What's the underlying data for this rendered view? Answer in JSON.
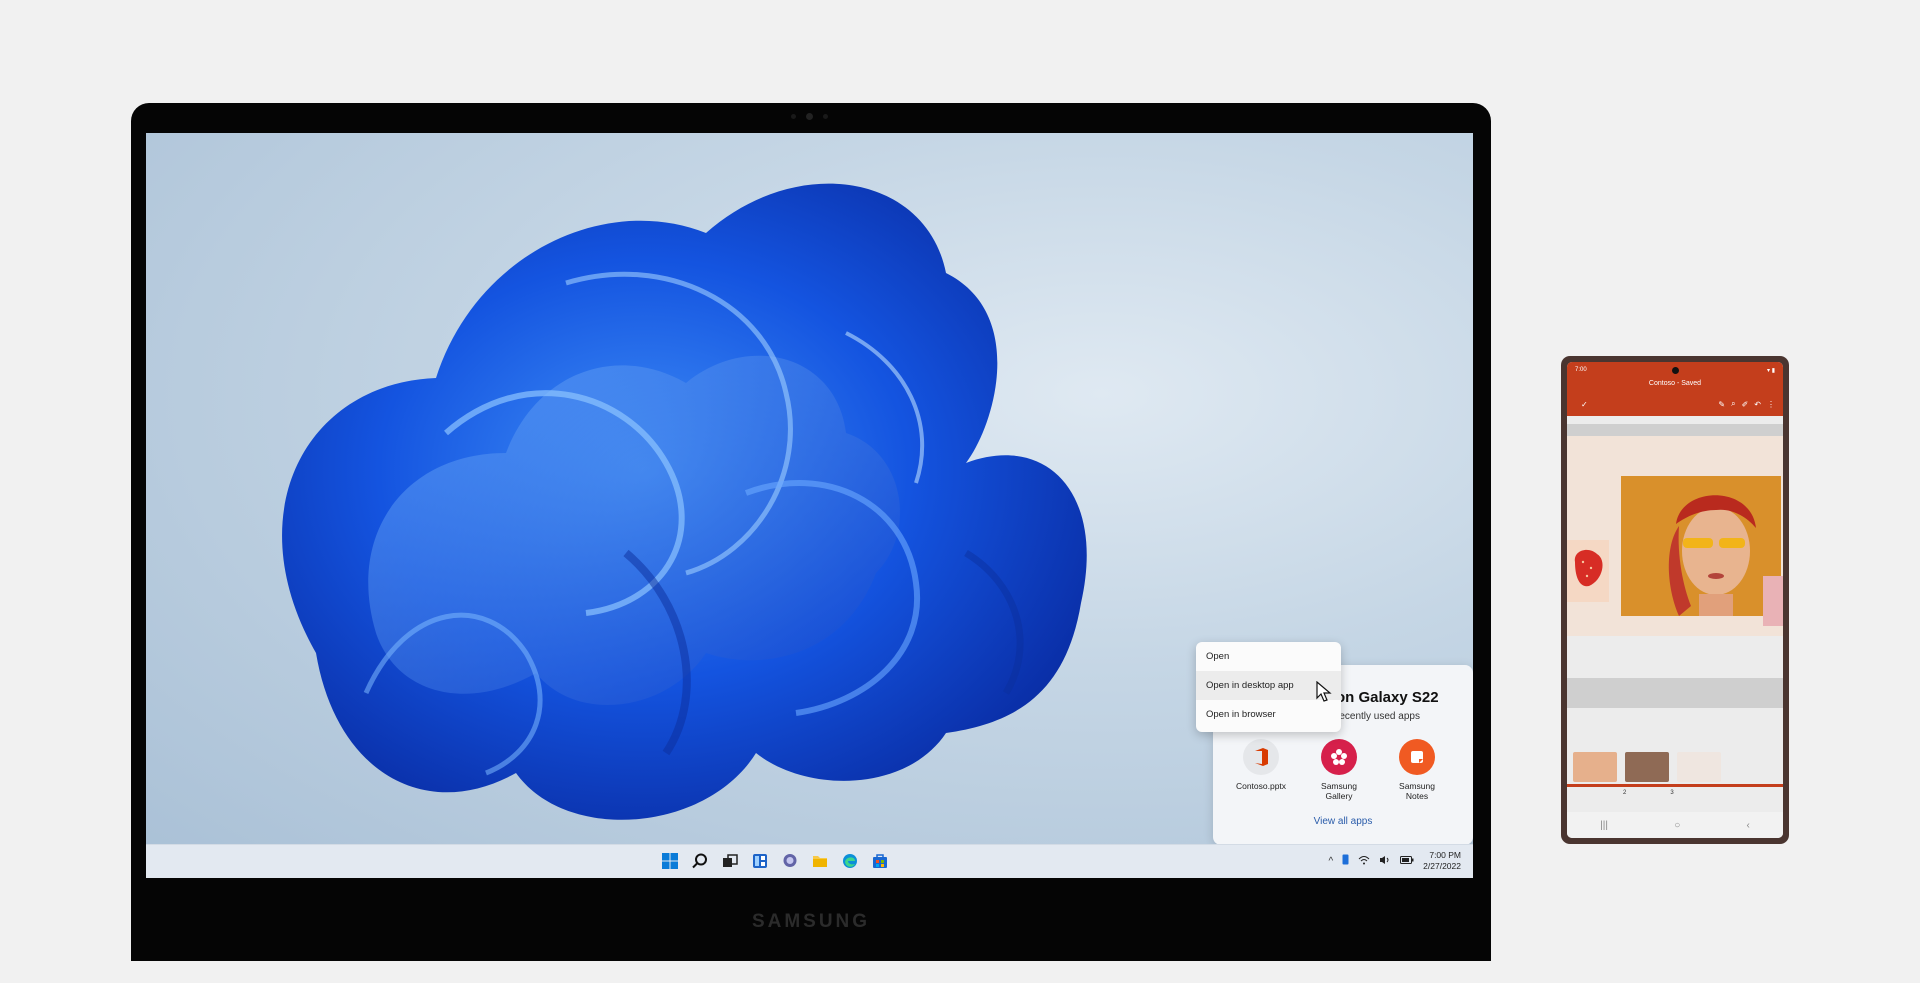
{
  "laptop": {
    "brand": "SAMSUNG",
    "context_menu": {
      "items": [
        "Open",
        "Open in desktop app",
        "Open in browser"
      ],
      "highlighted": "Open in desktop app"
    },
    "phone_link": {
      "title": "on Galaxy S22",
      "subtitle": "recently used apps",
      "apps": [
        {
          "label": "Contoso.pptx",
          "icon": "office-icon",
          "color": "#e5e7ea"
        },
        {
          "label": "Samsung Gallery",
          "icon": "gallery-flower-icon",
          "color": "#d6204b"
        },
        {
          "label": "Samsung Notes",
          "icon": "notes-icon",
          "color": "#f05a22"
        }
      ],
      "view_all": "View all apps"
    },
    "taskbar": {
      "icons": [
        "windows-start-icon",
        "search-icon",
        "task-view-icon",
        "widgets-icon",
        "chat-icon",
        "file-explorer-icon",
        "edge-icon",
        "store-icon"
      ],
      "time": "7:00 PM",
      "date": "2/27/2022"
    }
  },
  "phone": {
    "status_time": "7:00",
    "doc_title": "Contoso - Saved",
    "slide_numbers": [
      "2",
      "3"
    ],
    "accent": "#c43e1c"
  }
}
